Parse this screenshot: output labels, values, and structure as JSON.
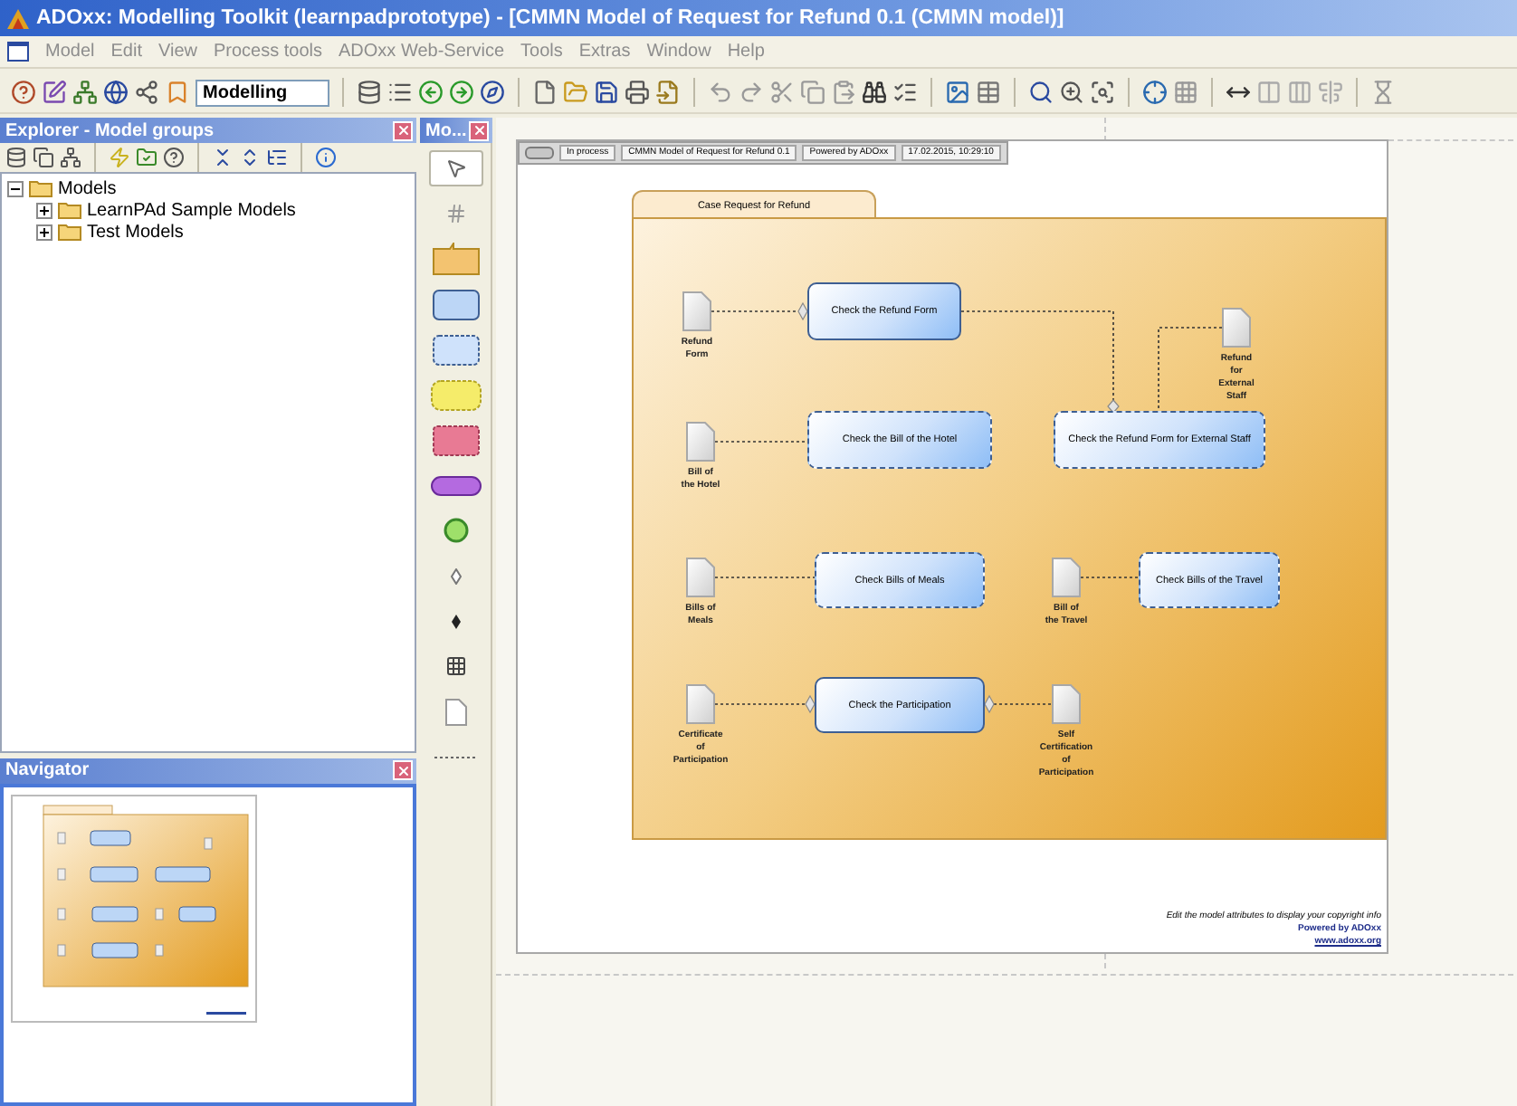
{
  "window": {
    "title": "ADOxx: Modelling Toolkit (learnpadprototype) - [CMMN Model of Request for Refund 0.1 (CMMN model)]"
  },
  "menu": [
    "Model",
    "Edit",
    "View",
    "Process tools",
    "ADOxx Web-Service",
    "Tools",
    "Extras",
    "Window",
    "Help"
  ],
  "toolbar": {
    "mode": "Modelling"
  },
  "explorer": {
    "title": "Explorer - Model groups",
    "tree": [
      {
        "label": "Models",
        "expanded": true,
        "children": [
          {
            "label": "LearnPAd Sample Models",
            "expanded": false
          },
          {
            "label": "Test Models",
            "expanded": false
          }
        ]
      }
    ]
  },
  "navigator": {
    "title": "Navigator"
  },
  "palette": {
    "title": "Mo...",
    "tools": [
      {
        "kind": "pointer",
        "selected": true
      },
      {
        "kind": "connector",
        "selected": false
      },
      {
        "kind": "case-file",
        "selected": false
      },
      {
        "kind": "task",
        "selected": false
      },
      {
        "kind": "discretionary-task",
        "selected": false
      },
      {
        "kind": "stage",
        "selected": false
      },
      {
        "kind": "plan-fragment",
        "selected": false
      },
      {
        "kind": "milestone",
        "selected": false
      },
      {
        "kind": "event",
        "selected": false
      },
      {
        "kind": "entry-criterion",
        "selected": false
      },
      {
        "kind": "exit-criterion",
        "selected": false
      },
      {
        "kind": "table",
        "selected": false
      },
      {
        "kind": "document",
        "selected": false
      },
      {
        "kind": "association",
        "selected": false
      }
    ]
  },
  "model": {
    "header": [
      "In process",
      "CMMN Model of Request for Refund 0.1",
      "Powered by ADOxx",
      "17.02.2015, 10:29:10"
    ],
    "case": {
      "title": "Case Request for Refund"
    },
    "nodes": [
      {
        "kind": "document",
        "label": "Refund\nForm"
      },
      {
        "kind": "task",
        "label": "Check the Refund Form",
        "discretionary": false
      },
      {
        "kind": "document",
        "label": "Refund\nfor\nExternal\nStaff"
      },
      {
        "kind": "document",
        "label": "Bill of\nthe Hotel"
      },
      {
        "kind": "task",
        "label": "Check the Bill of the Hotel",
        "discretionary": true
      },
      {
        "kind": "task",
        "label": "Check the Refund Form for External Staff",
        "discretionary": true
      },
      {
        "kind": "document",
        "label": "Bills of\nMeals"
      },
      {
        "kind": "task",
        "label": "Check Bills of Meals",
        "discretionary": true
      },
      {
        "kind": "document",
        "label": "Bill of\nthe Travel"
      },
      {
        "kind": "task",
        "label": "Check Bills of the Travel",
        "discretionary": true
      },
      {
        "kind": "document",
        "label": "Certificate\nof\nParticipation"
      },
      {
        "kind": "task",
        "label": "Check the Participation",
        "discretionary": false
      },
      {
        "kind": "document",
        "label": "Self\nCertification\nof\nParticipation"
      }
    ],
    "footer": {
      "note": "Edit the model attributes to display your copyright info",
      "powered": "Powered by ADOxx",
      "link": "www.adoxx.org"
    }
  }
}
